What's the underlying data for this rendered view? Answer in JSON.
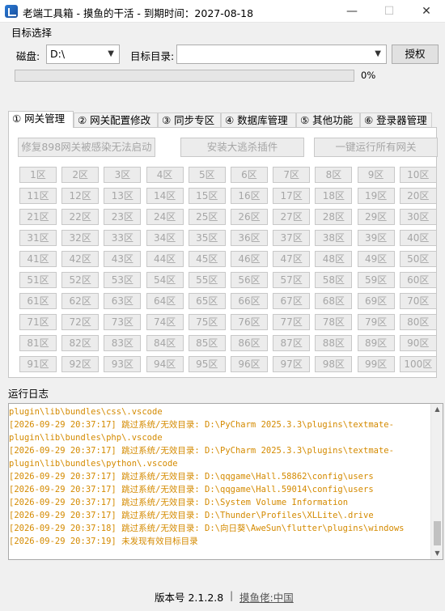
{
  "window": {
    "title": "老端工具箱 - 摸鱼的干活 - 到期时间：2027-08-18",
    "minimize": "—",
    "maximize": "☐",
    "close": "✕"
  },
  "target": {
    "group_title": "目标选择",
    "disk_label": "磁盘:",
    "disk_value": "D:\\",
    "dir_label": "目标目录:",
    "dir_value": "",
    "auth_button": "授权",
    "progress_percent": 0,
    "progress_text": "0%"
  },
  "tabs": [
    {
      "label": "① 网关管理",
      "active": true
    },
    {
      "label": "② 网关配置修改",
      "active": false
    },
    {
      "label": "③ 同步专区",
      "active": false
    },
    {
      "label": "④ 数据库管理",
      "active": false
    },
    {
      "label": "⑤ 其他功能",
      "active": false
    },
    {
      "label": "⑥ 登录器管理",
      "active": false
    }
  ],
  "actions": {
    "repair": "修复898网关被感染无法启动",
    "install_plugin": "安装大逃杀插件",
    "run_all": "一键运行所有网关"
  },
  "zones": [
    "1区",
    "2区",
    "3区",
    "4区",
    "5区",
    "6区",
    "7区",
    "8区",
    "9区",
    "10区",
    "11区",
    "12区",
    "13区",
    "14区",
    "15区",
    "16区",
    "17区",
    "18区",
    "19区",
    "20区",
    "21区",
    "22区",
    "23区",
    "24区",
    "25区",
    "26区",
    "27区",
    "28区",
    "29区",
    "30区",
    "31区",
    "32区",
    "33区",
    "34区",
    "35区",
    "36区",
    "37区",
    "38区",
    "39区",
    "40区",
    "41区",
    "42区",
    "43区",
    "44区",
    "45区",
    "46区",
    "47区",
    "48区",
    "49区",
    "50区",
    "51区",
    "52区",
    "53区",
    "54区",
    "55区",
    "56区",
    "57区",
    "58区",
    "59区",
    "60区",
    "61区",
    "62区",
    "63区",
    "64区",
    "65区",
    "66区",
    "67区",
    "68区",
    "69区",
    "70区",
    "71区",
    "72区",
    "73区",
    "74区",
    "75区",
    "76区",
    "77区",
    "78区",
    "79区",
    "80区",
    "81区",
    "82区",
    "83区",
    "84区",
    "85区",
    "86区",
    "87区",
    "88区",
    "89区",
    "90区",
    "91区",
    "92区",
    "93区",
    "94区",
    "95区",
    "96区",
    "97区",
    "98区",
    "99区",
    "100区"
  ],
  "log": {
    "title": "运行日志",
    "lines": [
      "plugin\\lib\\bundles\\css\\.vscode",
      "[2026-09-29 20:37:17] 跳过系统/无效目录: D:\\PyCharm 2025.3.3\\plugins\\textmate-",
      "plugin\\lib\\bundles\\php\\.vscode",
      "[2026-09-29 20:37:17] 跳过系统/无效目录: D:\\PyCharm 2025.3.3\\plugins\\textmate-",
      "plugin\\lib\\bundles\\python\\.vscode",
      "[2026-09-29 20:37:17] 跳过系统/无效目录: D:\\qqgame\\Hall.58862\\config\\users",
      "[2026-09-29 20:37:17] 跳过系统/无效目录: D:\\qqgame\\Hall.59014\\config\\users",
      "[2026-09-29 20:37:17] 跳过系统/无效目录: D:\\System Volume Information",
      "[2026-09-29 20:37:17] 跳过系统/无效目录: D:\\Thunder\\Profiles\\XLLite\\.drive",
      "[2026-09-29 20:37:18] 跳过系统/无效目录: D:\\向日葵\\AweSun\\flutter\\plugins\\windows",
      "[2026-09-29 20:37:19] 未发现有效目标目录"
    ]
  },
  "footer": {
    "version": "版本号 2.1.2.8",
    "separator": "|",
    "link": "摸鱼佬:中国"
  }
}
